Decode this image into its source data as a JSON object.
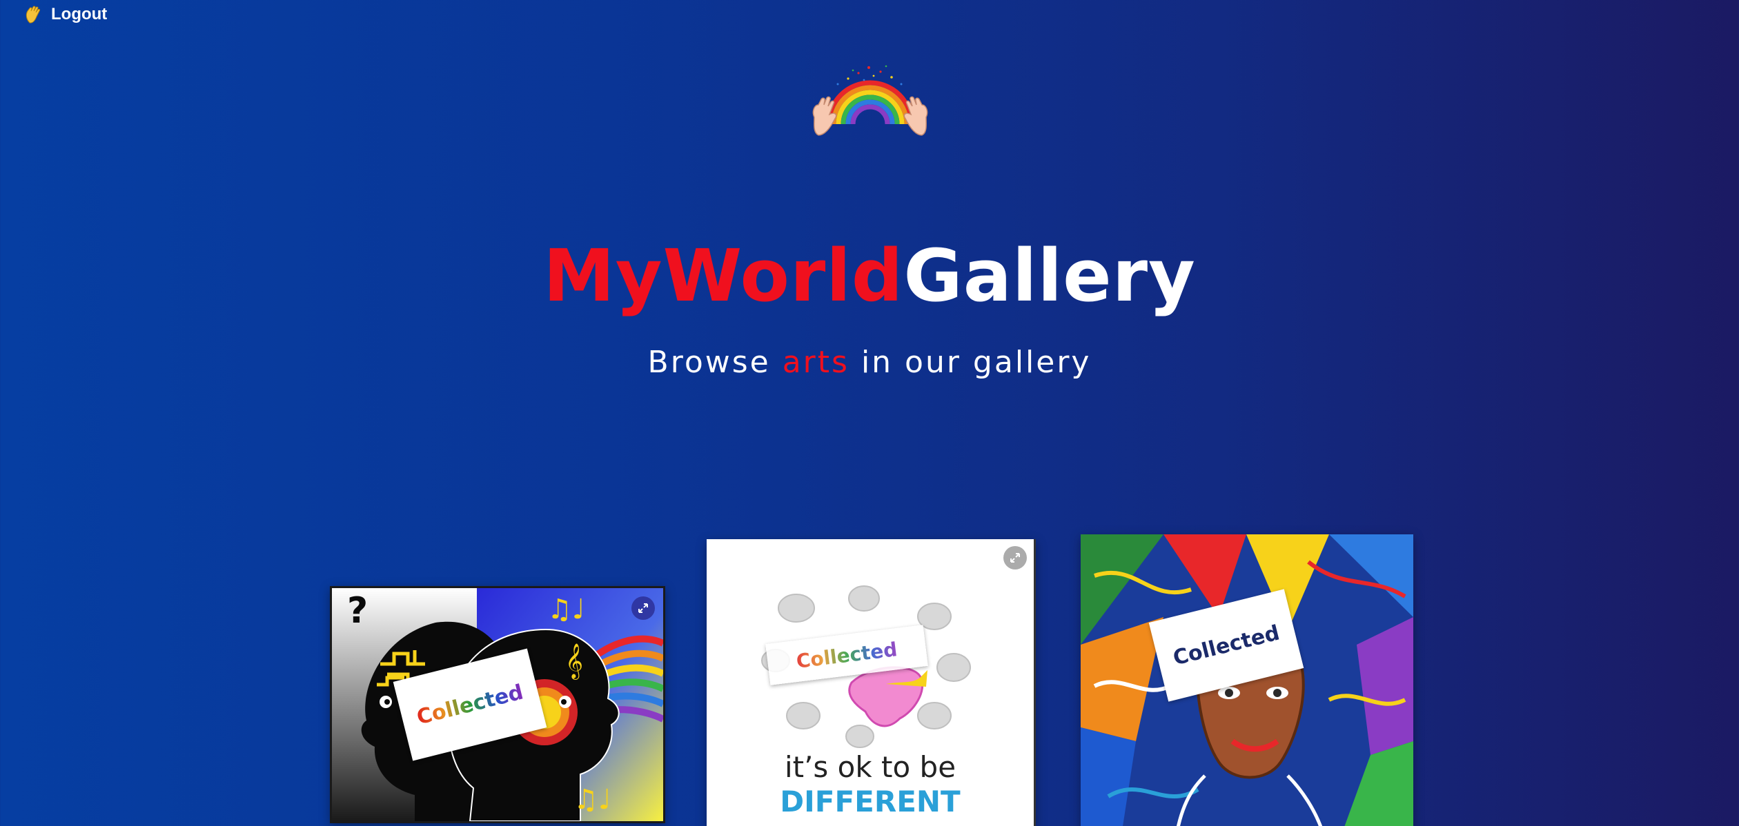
{
  "header": {
    "logout_label": "Logout",
    "logout_icon": "waving-hand-icon"
  },
  "hero": {
    "logo_icon": "rainbow-hands-icon",
    "brand_part1": "MyWorld",
    "brand_part2": "Gallery",
    "subtitle_before": "Browse ",
    "subtitle_accent": "arts",
    "subtitle_after": " in our gallery"
  },
  "colors": {
    "accent": "#f0101e",
    "background_start": "#063ea2",
    "background_end": "#1b1a63"
  },
  "gallery": {
    "cards": [
      {
        "stamp_label": "Collected",
        "expand_icon": "expand-icon"
      },
      {
        "stamp_label": "Collected",
        "expand_icon": "expand-icon",
        "art_text_line1": "it’s ok to be",
        "art_text_line2": "DIFFERENT"
      },
      {
        "stamp_label": "Collected"
      }
    ]
  }
}
